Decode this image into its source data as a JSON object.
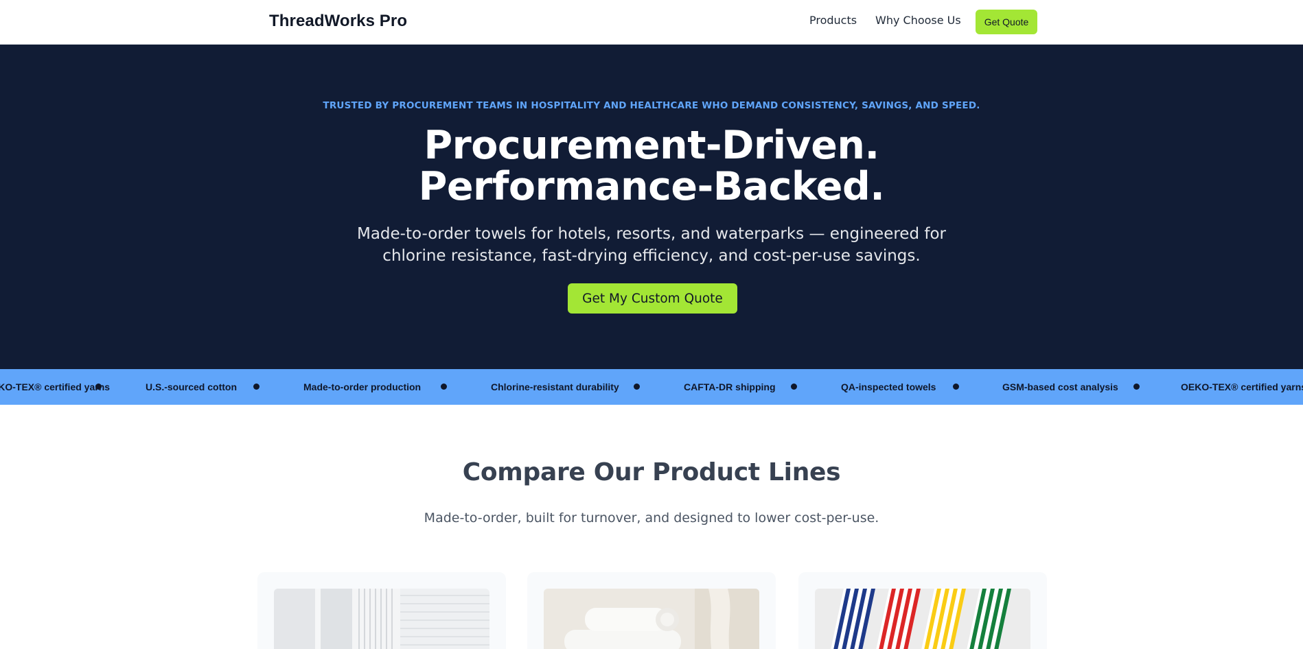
{
  "header": {
    "brand": "ThreadWorks Pro",
    "nav": {
      "products": "Products",
      "why": "Why Choose Us",
      "quote": "Get Quote"
    }
  },
  "hero": {
    "eyebrow": "TRUSTED BY PROCUREMENT TEAMS IN HOSPITALITY AND HEALTHCARE WHO DEMAND CONSISTENCY, SAVINGS, AND SPEED.",
    "title_line1": "Procurement-Driven.",
    "title_line2": "Performance-Backed.",
    "subtitle": "Made-to-order towels for hotels, resorts, and waterparks — engineered for chlorine resistance, fast-drying efficiency, and cost-per-use savings.",
    "cta": "Get My Custom Quote"
  },
  "marquee": {
    "items": [
      "OEKO-TEX® certified yarns",
      "U.S.-sourced cotton",
      "Made-to-order production",
      "Chlorine-resistant durability",
      "CAFTA-DR shipping",
      "QA-inspected towels",
      "GSM-based cost analysis",
      "OEKO-TEX® certified yarns"
    ]
  },
  "compare": {
    "title": "Compare Our Product Lines",
    "subtitle": "Made-to-order, built for turnover, and designed to lower cost-per-use."
  },
  "colors": {
    "navy": "#111c35",
    "accent_green": "#a3e635",
    "accent_blue": "#60a5fa"
  }
}
